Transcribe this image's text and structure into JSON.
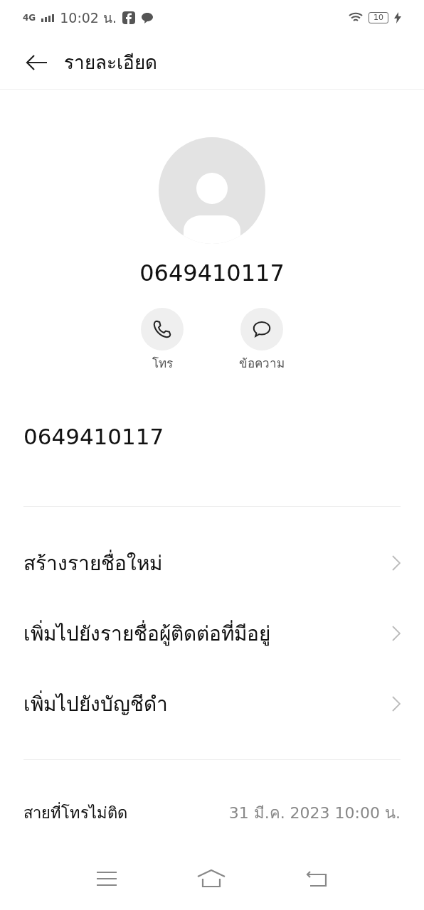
{
  "status_bar": {
    "network": "4G",
    "time": "10:02 น.",
    "battery": "10",
    "charging": true
  },
  "header": {
    "title": "รายละเอียด"
  },
  "contact": {
    "name": "0649410117"
  },
  "actions": [
    {
      "kind": "call",
      "label": "โทร"
    },
    {
      "kind": "message",
      "label": "ข้อความ"
    }
  ],
  "number": "0649410117",
  "menu_items": [
    "สร้างรายชื่อใหม่",
    "เพิ่มไปยังรายชื่อผู้ติดต่อที่มีอยู่",
    "เพิ่มไปยังบัญชีดำ"
  ],
  "call_log": {
    "label": "สายที่โทรไม่ติด",
    "time": "31 มี.ค. 2023 10:00 น."
  }
}
